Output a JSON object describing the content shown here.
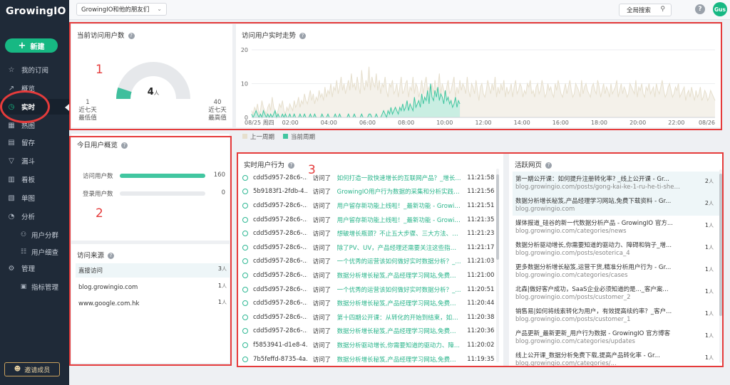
{
  "app": {
    "logo_text": "GrowingIO",
    "project_select": "GrowingIO和他的朋友们",
    "global_search": "全局搜索",
    "help": "?",
    "avatar_initials": "Gus"
  },
  "sidebar": {
    "new_label": "新建",
    "items": [
      {
        "label": "我的订阅",
        "icon": "star-icon"
      },
      {
        "label": "概览",
        "icon": "trend-icon"
      },
      {
        "label": "实时",
        "icon": "clock-icon",
        "active": true
      },
      {
        "label": "热图",
        "icon": "heatmap-icon"
      },
      {
        "label": "留存",
        "icon": "retention-icon"
      },
      {
        "label": "漏斗",
        "icon": "funnel-icon"
      },
      {
        "label": "看板",
        "icon": "board-icon"
      },
      {
        "label": "单图",
        "icon": "chart-icon"
      },
      {
        "label": "分析",
        "icon": "analysis-icon"
      },
      {
        "label": "用户分群",
        "icon": "group-icon"
      },
      {
        "label": "用户细查",
        "icon": "user-detail-icon"
      },
      {
        "label": "管理",
        "icon": "gear-icon"
      },
      {
        "label": "指标管理",
        "icon": "metric-icon"
      }
    ],
    "invite_label": "邀请成员"
  },
  "current_users": {
    "title": "当前访问用户数",
    "value": "4",
    "unit": "人",
    "min_value": "1",
    "min_label1": "近七天",
    "min_label2": "最低值",
    "max_value": "40",
    "max_label1": "近七天",
    "max_label2": "最高值",
    "gauge_fraction": 0.1
  },
  "trend": {
    "title": "访问用户实时走势",
    "legend_prev": "上一周期",
    "legend_curr": "当前周期",
    "color_prev": "#e6dfcd",
    "color_curr": "#41c6a0"
  },
  "chart_data": {
    "type": "area",
    "title": "访问用户实时走势",
    "x_ticks": [
      "08/25 周四",
      "02:00",
      "04:00",
      "06:00",
      "08:00",
      "10:00",
      "12:00",
      "14:00",
      "16:00",
      "18:00",
      "20:00",
      "22:00",
      "08/26"
    ],
    "y_ticks": [
      "0",
      "10",
      "20"
    ],
    "ylim": [
      0,
      20
    ],
    "grid": true,
    "series": [
      {
        "name": "上一周期",
        "values": [
          2,
          1,
          3,
          2,
          4,
          1,
          2,
          5,
          3,
          2,
          1,
          3,
          4,
          2,
          6,
          3,
          2,
          1,
          2,
          4,
          3,
          5,
          2,
          1,
          3,
          2,
          4,
          3,
          2,
          5,
          3,
          4,
          6,
          3,
          5,
          4,
          7,
          5,
          4,
          6,
          8,
          5,
          7,
          4,
          6,
          5,
          8,
          6,
          7,
          5,
          9,
          6,
          8,
          7,
          10,
          6,
          9,
          8,
          11,
          7,
          9,
          12,
          8,
          10,
          7,
          9,
          11,
          8,
          13,
          9,
          10,
          8,
          12,
          9,
          7,
          14,
          10,
          8,
          11,
          9,
          15,
          8,
          12,
          10,
          9,
          13,
          8,
          11,
          7,
          10,
          9,
          12,
          8,
          6,
          10,
          9,
          11,
          7,
          8,
          10,
          6,
          9,
          12,
          7,
          8,
          10,
          11,
          6,
          9,
          8,
          12,
          7,
          10,
          9,
          6,
          8,
          11,
          7,
          10,
          12,
          8,
          9,
          6,
          10,
          7,
          11,
          8,
          9,
          13,
          7,
          10,
          8,
          6,
          9,
          11,
          7,
          8,
          10,
          12,
          6,
          9,
          7,
          11,
          8,
          10,
          9,
          7,
          12,
          8,
          6,
          10,
          9,
          7,
          11,
          8,
          5,
          9,
          10,
          7,
          6,
          8,
          11,
          9,
          7,
          10,
          8,
          12,
          6,
          9,
          7,
          10,
          8,
          11,
          6,
          9,
          7,
          8,
          10,
          6,
          9,
          11,
          7,
          8,
          10,
          9,
          6,
          8,
          7,
          10,
          9,
          11,
          7,
          8,
          6,
          9,
          10,
          7,
          8,
          11,
          9,
          6,
          7,
          10,
          8,
          9,
          7,
          6,
          10,
          8,
          11,
          9,
          7,
          6,
          8,
          10,
          7,
          9,
          11,
          8,
          6,
          7,
          10,
          9,
          8,
          6,
          11,
          7,
          9,
          10,
          8,
          7,
          6,
          9,
          10,
          8,
          7,
          11,
          9,
          6,
          8,
          10,
          7,
          9,
          8,
          6,
          10,
          7,
          8,
          9,
          11,
          6,
          8,
          10,
          7,
          9,
          8,
          6,
          7,
          10,
          9,
          8,
          7,
          11,
          6,
          9,
          8,
          10,
          7,
          6,
          9,
          8,
          10,
          7,
          8,
          9,
          6,
          10,
          8,
          7,
          9,
          11,
          8,
          6,
          7,
          9,
          10,
          8,
          6,
          7,
          9,
          8,
          10,
          6,
          7,
          8,
          9,
          5,
          7,
          8,
          6,
          9,
          7,
          5,
          8,
          6,
          7,
          9,
          5,
          6,
          8,
          7,
          5,
          6,
          8,
          7,
          6,
          5
        ]
      },
      {
        "name": "当前周期",
        "values": [
          1,
          0,
          1,
          2,
          1,
          0,
          1,
          0,
          2,
          1,
          0,
          1,
          0,
          1,
          0,
          1,
          2,
          0,
          1,
          0,
          0,
          1,
          0,
          1,
          0,
          0,
          1,
          0,
          0,
          1,
          0,
          0,
          0,
          1,
          0,
          0,
          1,
          0,
          0,
          0,
          1,
          0,
          0,
          1,
          0,
          0,
          0,
          0,
          1,
          0,
          0,
          0,
          1,
          0,
          0,
          0,
          0,
          1,
          0,
          0,
          1,
          0,
          0,
          0,
          0,
          0,
          1,
          0,
          0,
          0,
          1,
          0,
          0,
          0,
          0,
          1,
          0,
          0,
          0,
          0,
          1,
          1,
          0,
          0,
          0,
          1,
          0,
          0,
          0,
          1,
          2,
          1,
          0,
          2,
          1,
          3,
          1,
          2,
          3,
          2,
          1,
          3,
          2,
          4,
          2,
          3,
          5,
          2,
          4,
          3,
          2,
          6,
          3,
          4,
          5,
          3,
          7,
          4,
          6,
          5,
          8,
          4,
          10,
          6,
          5,
          8,
          6,
          9,
          5,
          7,
          6,
          4,
          8,
          5,
          6,
          4,
          5,
          3,
          4,
          6,
          3,
          5,
          4
        ]
      }
    ]
  },
  "overview": {
    "title": "今日用户概览",
    "rows": [
      {
        "label": "访问用户数",
        "value": "160",
        "fraction": 1.0
      },
      {
        "label": "登录用户数",
        "value": "0",
        "fraction": 0.0
      }
    ]
  },
  "sources": {
    "title": "访问来源",
    "unit": "人",
    "rows": [
      {
        "label": "直接访问",
        "count": "3"
      },
      {
        "label": "blog.growingio.com",
        "count": "1"
      },
      {
        "label": "www.google.com.hk",
        "count": "1"
      }
    ]
  },
  "activity": {
    "title": "实时用户行为",
    "rows": [
      {
        "user": "cdd5d957-28c6-...",
        "verb": "访问了",
        "page": "如何打造一款快速增长的互联网产品？_增长...",
        "time": "11:21:58"
      },
      {
        "user": "5b9183f1-2fdb-4...",
        "verb": "访问了",
        "page": "GrowingIO用户行为数据的采集和分析实践_...",
        "time": "11:21:56"
      },
      {
        "user": "cdd5d957-28c6-...",
        "verb": "访问了",
        "page": "用户留存新功能上线啦！_最新功能 - Growin...",
        "time": "11:21:51"
      },
      {
        "user": "cdd5d957-28c6-...",
        "verb": "访问了",
        "page": "用户留存新功能上线啦！_最新功能 - Growin...",
        "time": "11:21:35"
      },
      {
        "user": "cdd5d957-28c6-...",
        "verb": "访问了",
        "page": "想破增长瓶颈？不止五大步骤、三大方法、一...",
        "time": "11:21:23"
      },
      {
        "user": "cdd5d957-28c6-...",
        "verb": "访问了",
        "page": "除了PV、UV，产品经理还需要关注这些指标_...",
        "time": "11:21:17"
      },
      {
        "user": "cdd5d957-28c6-...",
        "verb": "访问了",
        "page": "一个优秀的运营该如何做好实时数据分析？_...",
        "time": "11:21:03"
      },
      {
        "user": "cdd5d957-28c6-...",
        "verb": "访问了",
        "page": "数据分析增长秘笈,产品经理学习网站,免费下...",
        "time": "11:21:00"
      },
      {
        "user": "cdd5d957-28c6-...",
        "verb": "访问了",
        "page": "一个优秀的运营该如何做好实时数据分析？_...",
        "time": "11:20:51"
      },
      {
        "user": "cdd5d957-28c6-...",
        "verb": "访问了",
        "page": "数据分析增长秘笈,产品经理学习网站,免费下...",
        "time": "11:20:44"
      },
      {
        "user": "cdd5d957-28c6-...",
        "verb": "访问了",
        "page": "第十四期公开课：从转化的开始到结束，如何...",
        "time": "11:20:38"
      },
      {
        "user": "cdd5d957-28c6-...",
        "verb": "访问了",
        "page": "数据分析增长秘笈,产品经理学习网站,免费下...",
        "time": "11:20:36"
      },
      {
        "user": "f5853941-d1e8-4...",
        "verb": "访问了",
        "page": "数据分析驱动增长,你需要知道的驱动力、障...",
        "time": "11:20:02"
      },
      {
        "user": "7b5feffd-8735-4a...",
        "verb": "访问了",
        "page": "数据分析增长秘笈,产品经理学习网站,免费下...",
        "time": "11:19:35"
      }
    ]
  },
  "pages": {
    "title": "活跃网页",
    "unit": "人",
    "rows": [
      {
        "title": "第一期公开课：如何提升注册转化率? _线上公开课 - Gr...",
        "url": "blog.growingio.com/posts/gong-kai-ke-1-ru-he-ti-shen...",
        "count": "2"
      },
      {
        "title": "数据分析增长秘笈,产品经理学习网站,免费下载资料 - Gr...",
        "url": "blog.growingio.com",
        "count": "2"
      },
      {
        "title": "媒体报道_硅谷的新一代数据分析产品 - GrowingIO 官方...",
        "url": "blog.growingio.com/categories/news",
        "count": "1"
      },
      {
        "title": "数据分析驱动增长,你需要知道的驱动力、障碍和钩子_增...",
        "url": "blog.growingio.com/posts/esoterica_4",
        "count": "1"
      },
      {
        "title": "更多数据分析增长秘笈,运营干货,精准分析用户行为 - Gr...",
        "url": "blog.growingio.com/categories/cases",
        "count": "1"
      },
      {
        "title": "北森|做好客户成功，SaaS企业必须知道的是..._客户案...",
        "url": "blog.growingio.com/posts/customer_2",
        "count": "1"
      },
      {
        "title": "销售易|如何将线索转化为用户，有效提高续约率？_客户...",
        "url": "blog.growingio.com/posts/customer_1",
        "count": "1"
      },
      {
        "title": "产品更新_最新更新_用户行为数据 - GrowingIO 官方博客",
        "url": "blog.growingio.com/categories/updates",
        "count": "1"
      },
      {
        "title": "线上公开课_数据分析免费下载,提高产品转化率 - Gr...",
        "url": "blog.growingio.com/categories/...",
        "count": "1"
      }
    ]
  },
  "annotations": {
    "n1": "1",
    "n2": "2",
    "n3": "3"
  }
}
